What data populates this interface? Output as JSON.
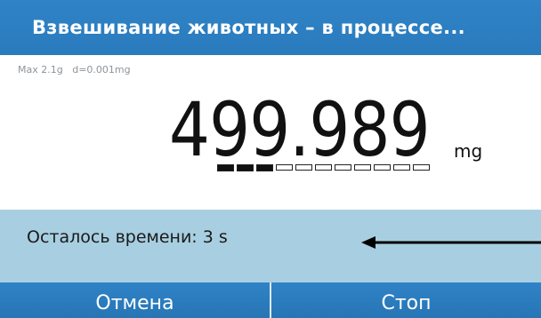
{
  "header": {
    "title": "Взвешивание животных – в процессе..."
  },
  "scale": {
    "max_capacity": "Max 2.1g",
    "readability": "d=0.001mg",
    "weight_value": "499.989",
    "unit": "mg",
    "stability_segments_total": 11,
    "stability_segments_filled": 3
  },
  "status": {
    "time_remaining": "Осталось времени: 3 s"
  },
  "buttons": {
    "cancel_label": "Отмена",
    "stop_label": "Стоп"
  },
  "colors": {
    "accent": "#2a7bbd",
    "status_panel": "#a8cfe1"
  }
}
